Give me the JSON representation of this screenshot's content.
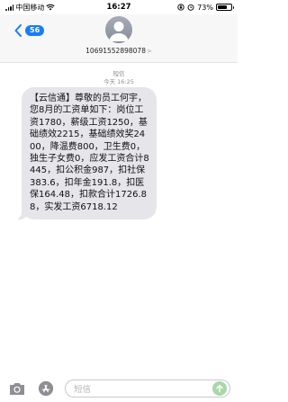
{
  "status_bar": {
    "carrier": "中国移动",
    "time": "16:27",
    "battery": "73%",
    "battery_level": 0.73
  },
  "header": {
    "back_badge": "56",
    "contact": "10691552898078",
    "chevron": ">"
  },
  "thread": {
    "label": "短信",
    "time": "今天 16:25"
  },
  "message": {
    "text": "【云信通】尊敬的员工何宇，您8月的工资单如下：岗位工资1780，薪级工资1250，基础绩效2215，基础绩效奖2400，降温费800，卫生费0，独生子女费0，应发工资合计8445，扣公积金987，扣社保383.6，扣年金191.8，扣医保164.48，扣款合计1726.88，实发工资6718.12"
  },
  "input": {
    "placeholder": "短信"
  },
  "colors": {
    "accent": "#1a7cf5",
    "bubble": "#e5e5ea",
    "send": "#a8d8a8"
  }
}
